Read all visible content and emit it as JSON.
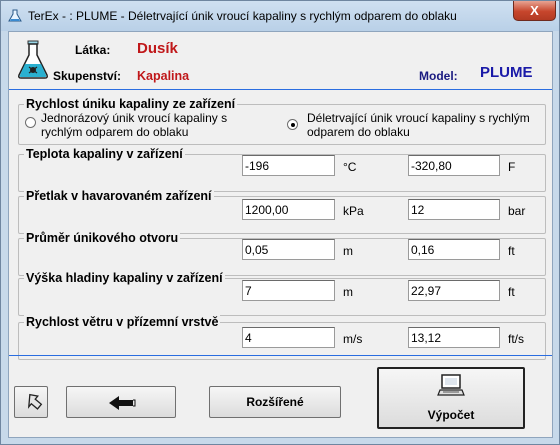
{
  "window": {
    "title": "TerEx - : PLUME - Déletrvající únik vroucí kapaliny s rychlým odparem do oblaku",
    "close_label": "X"
  },
  "header": {
    "substance_label": "Látka:",
    "substance_value": "Dusík",
    "state_label": "Skupenství:",
    "state_value": "Kapalina",
    "model_label": "Model:",
    "model_value": "PLUME"
  },
  "release_rate": {
    "title": "Rychlost úniku kapaliny ze zařízení",
    "option1": "Jednorázový únik vroucí kapaliny s rychlým odparem do oblaku",
    "option2": "Déletrvající únik vroucí kapaliny s rychlým odparem do oblaku",
    "selected": 2
  },
  "fields": [
    {
      "title": "Teplota kapaliny v zařízení",
      "value1": "-196",
      "unit1": "°C",
      "value2": "-320,80",
      "unit2": "F"
    },
    {
      "title": "Přetlak v havarovaném zařízení",
      "value1": "1200,00",
      "unit1": "kPa",
      "value2": "12",
      "unit2": "bar"
    },
    {
      "title": "Průměr únikového otvoru",
      "value1": "0,05",
      "unit1": "m",
      "value2": "0,16",
      "unit2": "ft"
    },
    {
      "title": "Výška hladiny kapaliny v zařízení",
      "value1": "7",
      "unit1": "m",
      "value2": "22,97",
      "unit2": "ft"
    },
    {
      "title": "Rychlost větru v přízemní vrstvě",
      "value1": "4",
      "unit1": "m/s",
      "value2": "13,12",
      "unit2": "ft/s"
    }
  ],
  "buttons": {
    "advanced_label": "Rozšířené",
    "calculate_label": "Výpočet"
  },
  "icons": {
    "exit": "exit-arrow-icon",
    "back": "back-arrow-icon",
    "calculate": "computer-icon",
    "flask": "flask-icon"
  }
}
